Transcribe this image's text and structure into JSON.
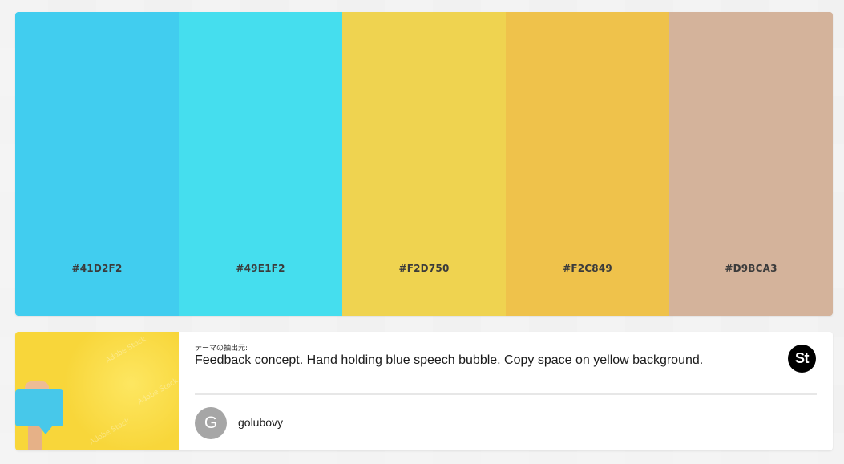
{
  "palette": {
    "swatches": [
      {
        "hex": "#41D2F2",
        "color": "#41CDEF"
      },
      {
        "hex": "#49E1F2",
        "color": "#45DEEE"
      },
      {
        "hex": "#F2D750",
        "color": "#EFD350"
      },
      {
        "hex": "#F2C849",
        "color": "#EFC24B"
      },
      {
        "hex": "#D9BCA3",
        "color": "#D4B39B"
      }
    ]
  },
  "source": {
    "extracted_label": "テーマの抽出元:",
    "title": "Feedback concept. Hand holding blue speech bubble. Copy space on yellow background.",
    "stock_badge": "St",
    "stock_icon": "adobe-stock-icon"
  },
  "author": {
    "avatar_initial": "G",
    "name": "golubovy"
  },
  "thumbnail": {
    "watermark": "Adobe Stock"
  }
}
